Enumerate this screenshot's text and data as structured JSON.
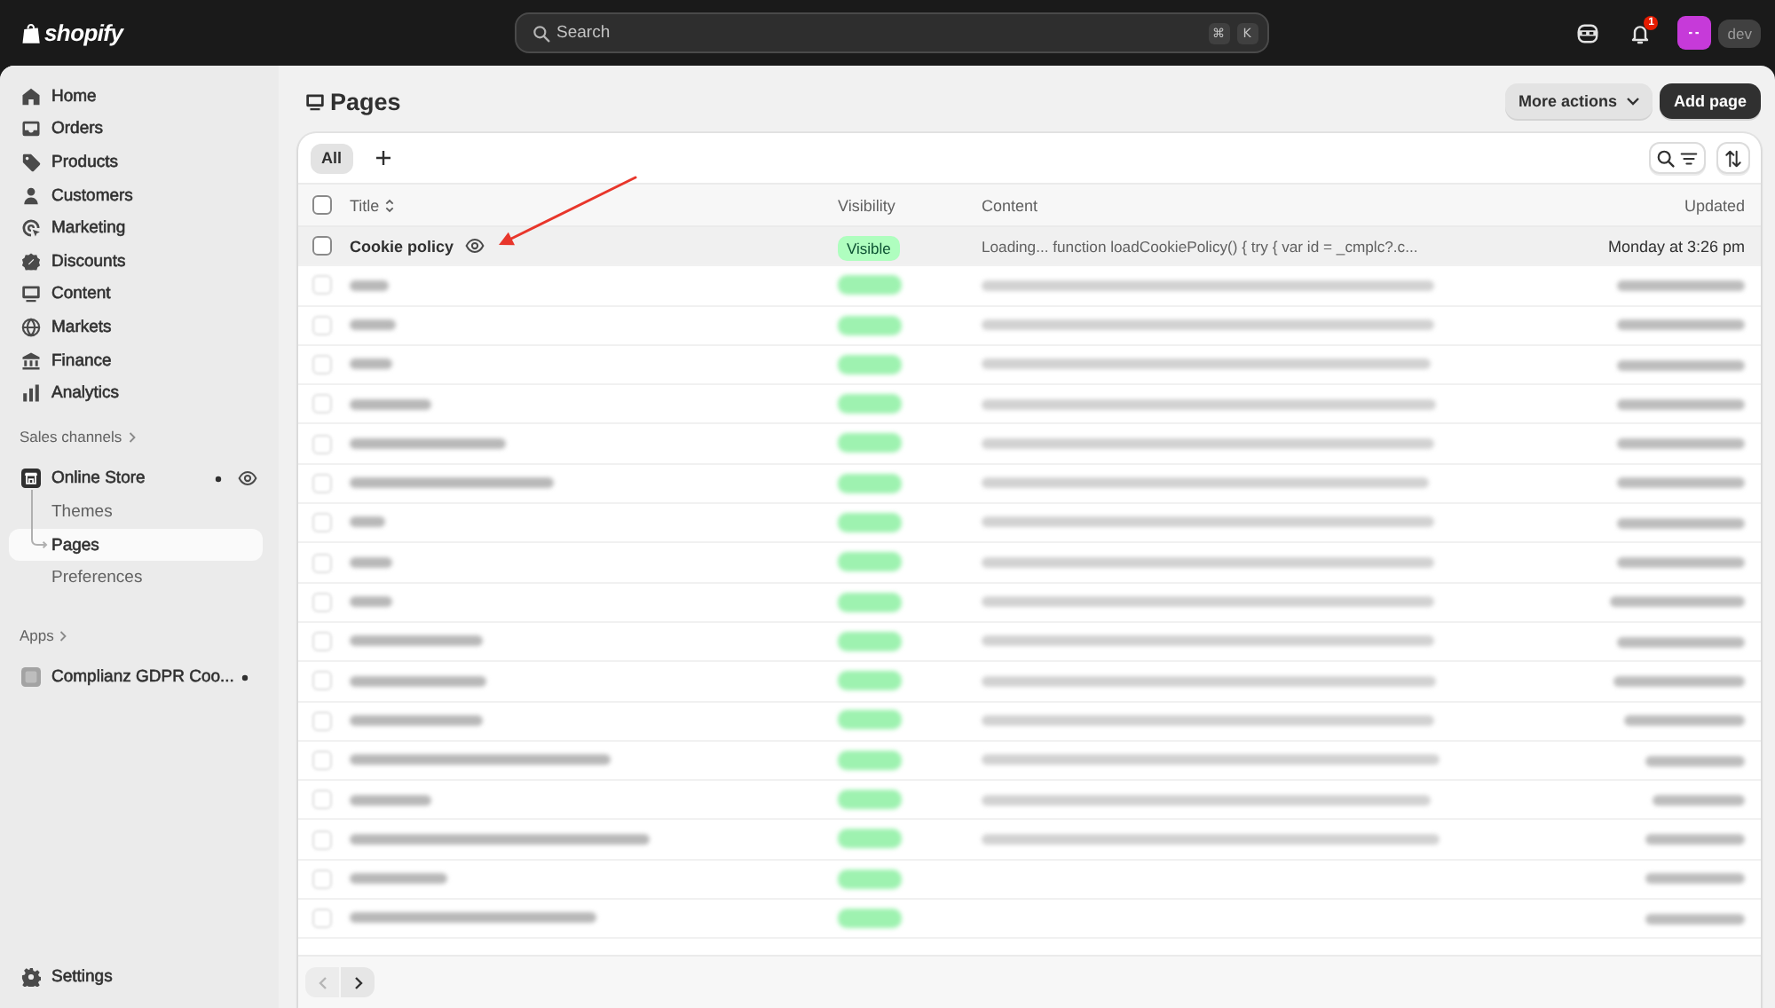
{
  "top_bar": {
    "logo": "shopify",
    "search": {
      "placeholder": "Search",
      "shortcut_keys": [
        "⌘",
        "K"
      ]
    },
    "notification_count": "1",
    "store_label": "dev"
  },
  "sidebar": {
    "items": [
      {
        "label": "Home",
        "selected": false
      },
      {
        "label": "Orders",
        "selected": false
      },
      {
        "label": "Products",
        "selected": false
      },
      {
        "label": "Customers",
        "selected": false
      },
      {
        "label": "Marketing",
        "selected": false
      },
      {
        "label": "Discounts",
        "selected": false
      },
      {
        "label": "Content",
        "selected": false
      },
      {
        "label": "Markets",
        "selected": false
      },
      {
        "label": "Finance",
        "selected": false
      },
      {
        "label": "Analytics",
        "selected": false
      }
    ],
    "sales_channels": {
      "heading": "Sales channels",
      "channels": [
        {
          "label": "Online Store",
          "children": [
            {
              "label": "Themes",
              "selected": false
            },
            {
              "label": "Pages",
              "selected": true
            },
            {
              "label": "Preferences",
              "selected": false
            }
          ]
        }
      ]
    },
    "apps": {
      "heading": "Apps",
      "items": [
        {
          "label": "Complianz GDPR Coo..."
        }
      ]
    },
    "settings": {
      "label": "Settings"
    }
  },
  "page": {
    "title": "Pages",
    "actions": [
      {
        "label": "More actions",
        "kind": "menu"
      },
      {
        "label": "Add page",
        "kind": "primary"
      }
    ]
  },
  "table": {
    "views": [
      {
        "label": "All",
        "selected": true
      }
    ],
    "all_selected": false,
    "columns": [
      {
        "label": "Title",
        "sortable": true
      },
      {
        "label": "Visibility",
        "sortable": false
      },
      {
        "label": "Content",
        "sortable": false
      },
      {
        "label": "Updated",
        "sortable": false
      }
    ],
    "rows": [
      {
        "kind": "page",
        "highlighted": true,
        "selected": false,
        "title": "Cookie policy",
        "visibility": "Visible",
        "content": "Loading... function loadCookiePolicy() { try { var id = _cmplc?.c...",
        "updated": "Monday at 3:26 pm"
      },
      {
        "kind": "blurred",
        "highlighted": false,
        "selected": false,
        "content_shown": true
      },
      {
        "kind": "blurred",
        "highlighted": false,
        "selected": false,
        "content_shown": true
      },
      {
        "kind": "blurred",
        "highlighted": false,
        "selected": false,
        "content_shown": true
      },
      {
        "kind": "blurred",
        "highlighted": false,
        "selected": false,
        "content_shown": true
      },
      {
        "kind": "blurred",
        "highlighted": false,
        "selected": false,
        "content_shown": true
      },
      {
        "kind": "blurred",
        "highlighted": false,
        "selected": false,
        "content_shown": true
      },
      {
        "kind": "blurred",
        "highlighted": false,
        "selected": false,
        "content_shown": true
      },
      {
        "kind": "blurred",
        "highlighted": false,
        "selected": false,
        "content_shown": true
      },
      {
        "kind": "blurred",
        "highlighted": false,
        "selected": false,
        "content_shown": true
      },
      {
        "kind": "blurred",
        "highlighted": false,
        "selected": false,
        "content_shown": true
      },
      {
        "kind": "blurred",
        "highlighted": false,
        "selected": false,
        "content_shown": true
      },
      {
        "kind": "blurred",
        "highlighted": false,
        "selected": false,
        "content_shown": true
      },
      {
        "kind": "blurred",
        "highlighted": false,
        "selected": false,
        "content_shown": true
      },
      {
        "kind": "blurred",
        "highlighted": false,
        "selected": false,
        "content_shown": true
      },
      {
        "kind": "blurred",
        "highlighted": false,
        "selected": false,
        "content_shown": true
      },
      {
        "kind": "blurred",
        "highlighted": false,
        "selected": false,
        "content_shown": false
      },
      {
        "kind": "blurred",
        "highlighted": false,
        "selected": false,
        "content_shown": false
      }
    ],
    "pagination": {
      "previous_disabled": true,
      "next_disabled": false
    }
  }
}
